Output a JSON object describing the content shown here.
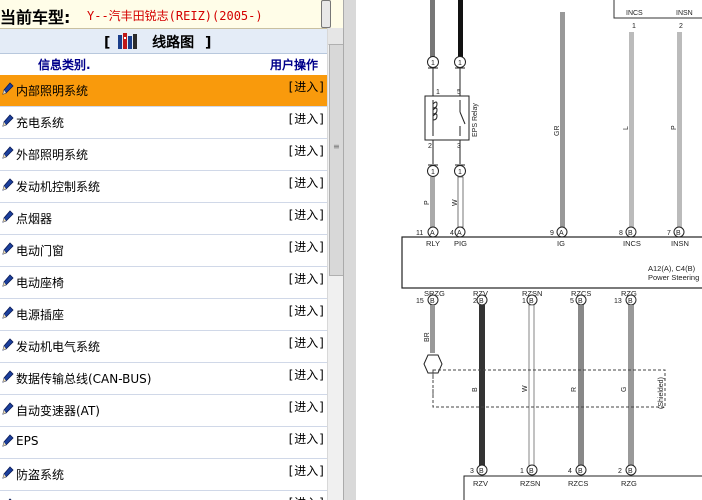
{
  "header": {
    "model_label": "当前车型:",
    "model_value": "Y--汽丰田锐志(REIZ)(2005-)"
  },
  "panel": {
    "title_open": "[",
    "title": "线路图",
    "title_close": "]",
    "col_category": "信息类别.",
    "col_action": "用户操作"
  },
  "items": [
    {
      "label": "内部照明系统",
      "action": "[进入]"
    },
    {
      "label": "充电系统",
      "action": "[进入]"
    },
    {
      "label": "外部照明系统",
      "action": "[进入]"
    },
    {
      "label": "发动机控制系统",
      "action": "[进入]"
    },
    {
      "label": "点烟器",
      "action": "[进入]"
    },
    {
      "label": "电动门窗",
      "action": "[进入]"
    },
    {
      "label": "电动座椅",
      "action": "[进入]"
    },
    {
      "label": "电源插座",
      "action": "[进入]"
    },
    {
      "label": "发动机电气系统",
      "action": "[进入]"
    },
    {
      "label": "数据传输总线(CAN-BUS)",
      "action": "[进入]"
    },
    {
      "label": "自动变速器(AT)",
      "action": "[进入]"
    },
    {
      "label": "EPS",
      "action": "[进入]"
    },
    {
      "label": "防盗系统",
      "action": "[进入]"
    },
    {
      "label": "后视镜/车窗",
      "action": "[进入]"
    }
  ],
  "selected_index": 0,
  "colors": {
    "selected_row": "#f99a0c",
    "model_text": "#d40000",
    "header_text": "#00008b"
  },
  "diagram": {
    "top_labels": [
      "INCS",
      "INSN"
    ],
    "top_pins": [
      "1",
      "2"
    ],
    "top_wire_colors": [
      "L",
      "P"
    ],
    "relay_name": "EPS Relay",
    "relay_pins": [
      "1",
      "5",
      "2",
      "3"
    ],
    "fuse_numbers": [
      "1",
      "1",
      "1",
      "1"
    ],
    "wire_colors_mid": [
      "P",
      "W",
      "GR"
    ],
    "conn_pins_top": [
      "11",
      "4",
      "9",
      "8",
      "7"
    ],
    "conn_letters_top": [
      "A",
      "A",
      "A",
      "B",
      "B"
    ],
    "conn_names_top": [
      "RLY",
      "PIG",
      "IG",
      "INCS",
      "INSN"
    ],
    "component_code": "A12(A), C4(B)",
    "component_name": "Power Steering E",
    "conn_names_bottom": [
      "SRZG",
      "RZV",
      "RZSN",
      "RZCS",
      "RZG"
    ],
    "conn_pins_bottom": [
      "15",
      "2",
      "1",
      "5",
      "13"
    ],
    "conn_letters_bottom": [
      "B",
      "B",
      "B",
      "B",
      "B"
    ],
    "wire_colors_low": [
      "BR",
      "B",
      "W",
      "R",
      "G"
    ],
    "shielded_label": "(Shielded)",
    "bottom_pins": [
      "3",
      "1",
      "4",
      "2"
    ],
    "bottom_letters": [
      "B",
      "B",
      "B",
      "B"
    ],
    "bottom_names": [
      "RZV",
      "RZSN",
      "RZCS",
      "RZG"
    ]
  }
}
